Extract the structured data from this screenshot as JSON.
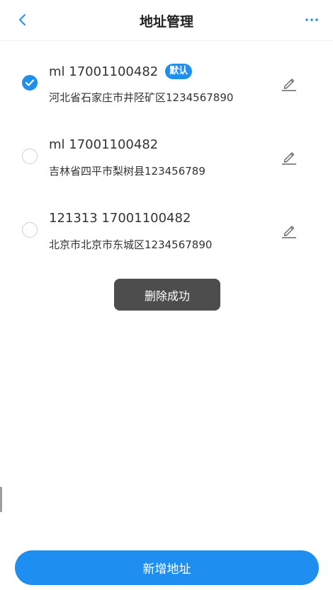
{
  "header": {
    "title": "地址管理",
    "back_icon": "chevron-left-icon",
    "more_icon": "more-horizontal-icon"
  },
  "addresses": [
    {
      "name_phone": "ml 17001100482",
      "badge": "默认",
      "address": "河北省石家庄市井陉矿区1234567890",
      "selected": true
    },
    {
      "name_phone": "ml 17001100482",
      "address": "吉林省四平市梨树县123456789",
      "selected": false
    },
    {
      "name_phone": "121313 17001100482",
      "address": "北京市北京市东城区1234567890",
      "selected": false
    }
  ],
  "toast": "删除成功",
  "add_button": "新增地址",
  "colors": {
    "accent": "#1f8ef1",
    "toast_bg": "#4d4d4d"
  }
}
